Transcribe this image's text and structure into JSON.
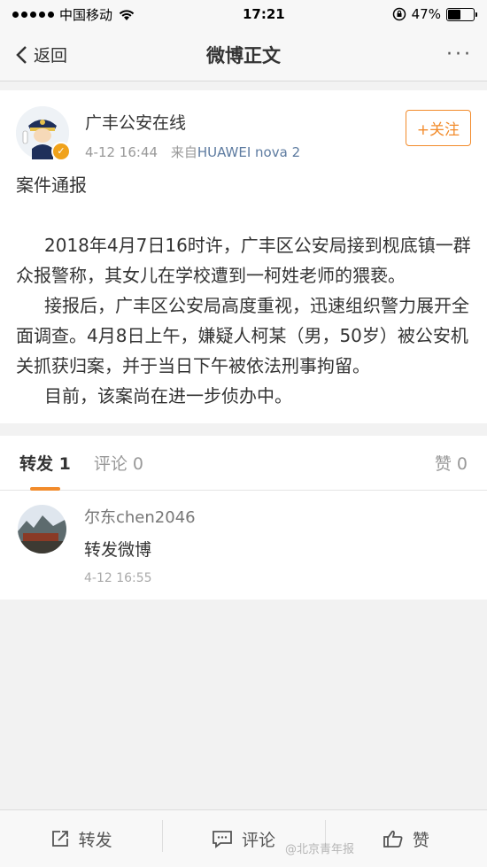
{
  "status_bar": {
    "carrier": "中国移动",
    "time": "17:21",
    "battery": "47%"
  },
  "navbar": {
    "back_label": "返回",
    "title": "微博正文",
    "more": "···"
  },
  "post": {
    "author": "广丰公安在线",
    "time": "4-12 16:44",
    "source_prefix": "来自",
    "source": "HUAWEI nova 2",
    "follow_label": "+关注",
    "title": "案件通报",
    "paragraphs": [
      "2018年4月7日16时许，广丰区公安局接到枧底镇一群众报警称，其女儿在学校遭到一柯姓老师的猥亵。",
      "接报后，广丰区公安局高度重视，迅速组织警力展开全面调查。4月8日上午，嫌疑人柯某（男，50岁）被公安机关抓获归案，并于当日下午被依法刑事拘留。",
      "目前，该案尚在进一步侦办中。"
    ]
  },
  "tabs": {
    "repost": "转发 1",
    "comment": "评论 0",
    "like": "赞 0"
  },
  "reposts": [
    {
      "name": "尔东chen2046",
      "text": "转发微博",
      "time": "4-12 16:55"
    }
  ],
  "bottom_bar": {
    "repost": "转发",
    "comment": "评论",
    "like": "赞"
  },
  "watermark": "@北京青年报",
  "colors": {
    "accent": "#f28b2b",
    "verified": "#f0a21b",
    "link": "#5d7ba0"
  }
}
